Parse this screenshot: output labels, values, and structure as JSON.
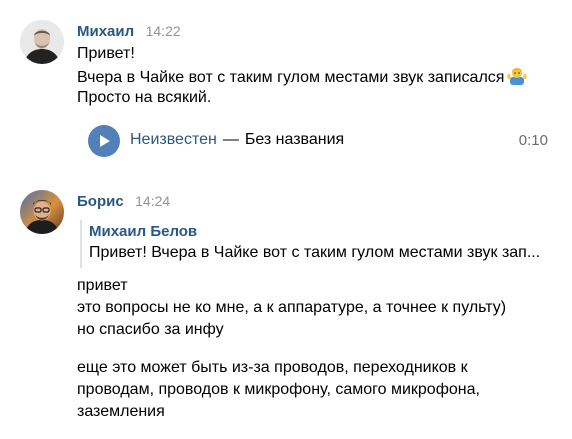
{
  "messages": [
    {
      "author": "Михаил",
      "time": "14:22",
      "lines": [
        "Привет!",
        "Вчера в Чайке вот с таким гулом местами звук записался",
        "Просто на всякий."
      ],
      "emoji": "person-shrugging-emoji",
      "audio": {
        "artist": "Неизвестен",
        "separator": "—",
        "title": "Без названия",
        "duration": "0:10",
        "icon": "play-icon"
      }
    },
    {
      "author": "Борис",
      "time": "14:24",
      "reply": {
        "author": "Михаил Белов",
        "text": "Привет! Вчера в Чайке вот с таким гулом местами звук зап..."
      },
      "paragraphs": [
        [
          "привет",
          "это вопросы не ко мне, а к аппаратуре, а точнее к пульту)",
          "но спасибо за инфу"
        ],
        [
          "еще это может быть из-за проводов, переходников к",
          "проводам, проводов к микрофону, самого микрофона,",
          "заземления"
        ]
      ]
    }
  ],
  "colors": {
    "author": "#2a5885",
    "timestamp": "#939393",
    "play_button": "#5181b8",
    "quote_border": "#dde2e8"
  }
}
